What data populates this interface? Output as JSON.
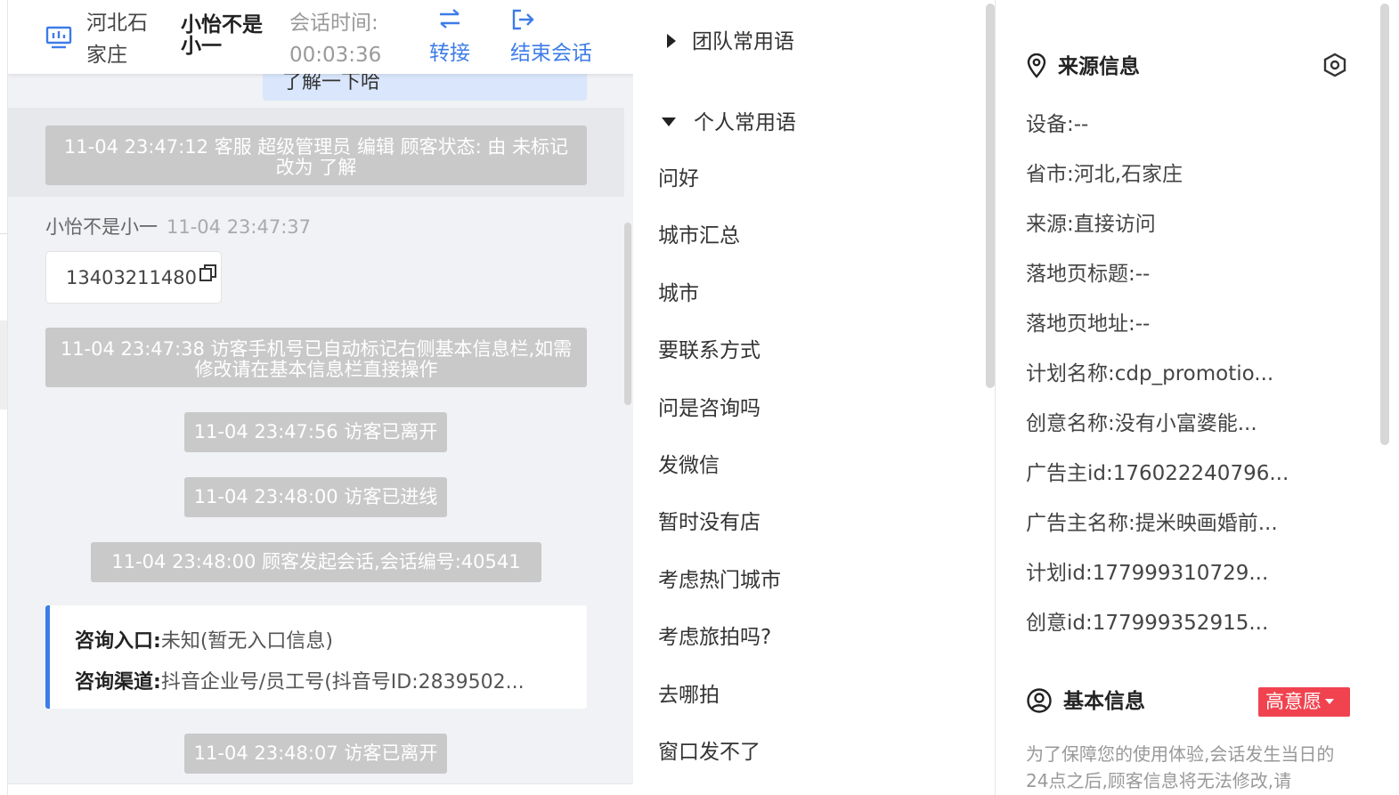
{
  "header": {
    "location": "河北石家庄",
    "visitor_name": "小怡不是小一",
    "session_time_label": "会话时间:",
    "session_time_value": "00:03:36",
    "transfer_label": "转接",
    "end_label": "结束会话",
    "accent_color": "#3d7ce8"
  },
  "chat": {
    "partial_bubble_text": "了解一下哈",
    "system_messages": [
      "11-04 23:47:12 客服 超级管理员 编辑 顾客状态: 由 未标记 改为 了解",
      "11-04 23:47:38 访客手机号已自动标记右侧基本信息栏,如需修改请在基本信息栏直接操作",
      "11-04 23:47:56 访客已离开",
      "11-04 23:48:00 访客已进线",
      "11-04 23:48:00 顾客发起会话,会话编号:40541",
      "11-04 23:48:07 访客已离开"
    ],
    "visitor_message": {
      "sender": "小怡不是小一",
      "time": "11-04 23:47:37",
      "text": "13403211480"
    },
    "entry_card": {
      "entry_label": "咨询入口:",
      "entry_value": "未知(暂无入口信息)",
      "channel_label": "咨询渠道:",
      "channel_value": "抖音企业号/员工号(抖音号ID:2839502..."
    }
  },
  "phrases": {
    "team_group": "团队常用语",
    "personal_group": "个人常用语",
    "items": [
      "问好",
      "城市汇总",
      "城市",
      "要联系方式",
      "问是咨询吗",
      "发微信",
      "暂时没有店",
      "考虑热门城市",
      "考虑旅拍吗?",
      "去哪拍",
      "窗口发不了"
    ]
  },
  "info": {
    "source_title": "来源信息",
    "source_items": [
      "设备:--",
      "省市:河北,石家庄",
      "来源:直接访问",
      "落地页标题:--",
      "落地页地址:--",
      "计划名称:cdp_promotio...",
      "创意名称:没有小富婆能...",
      "广告主id:176022240796...",
      "广告主名称:提米映画婚前...",
      "计划id:177999310729...",
      "创意id:177999352915..."
    ],
    "basic_title": "基本信息",
    "intent_badge": "高意愿",
    "intent_color": "#f0434f",
    "basic_note": "为了保障您的使用体验,会话发生当日的24点之后,顾客信息将无法修改,请"
  },
  "icons": [
    "monitor-icon",
    "transfer-icon",
    "logout-icon",
    "copy-icon",
    "triangle-right-icon",
    "triangle-down-icon",
    "location-pin-icon",
    "settings-icon",
    "user-circle-icon",
    "caret-down-icon"
  ]
}
